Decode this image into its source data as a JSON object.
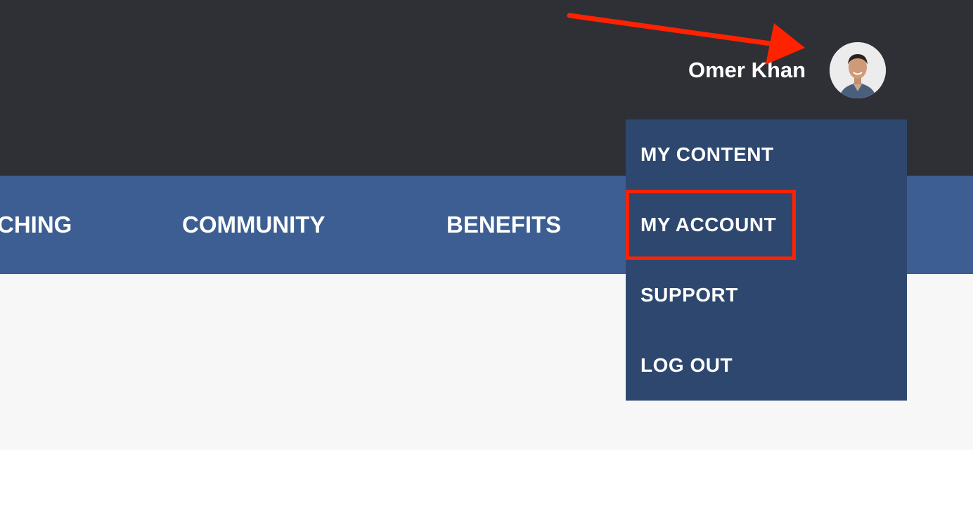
{
  "header": {
    "user_name": "Omer Khan",
    "avatar_icon": "user-avatar-photo"
  },
  "nav": {
    "items": [
      {
        "label": "CHING"
      },
      {
        "label": "COMMUNITY"
      },
      {
        "label": "BENEFITS"
      }
    ]
  },
  "user_menu": {
    "items": [
      {
        "label": "MY CONTENT"
      },
      {
        "label": "MY ACCOUNT"
      },
      {
        "label": "SUPPORT"
      },
      {
        "label": "LOG OUT"
      }
    ]
  },
  "annotation": {
    "color": "#ff2200",
    "highlighted_item": "MY ACCOUNT"
  },
  "colors": {
    "header_bg": "#2f3035",
    "nav_bg": "#3c5e92",
    "menu_bg": "#2d476f",
    "content_bg": "#f7f7f7"
  }
}
